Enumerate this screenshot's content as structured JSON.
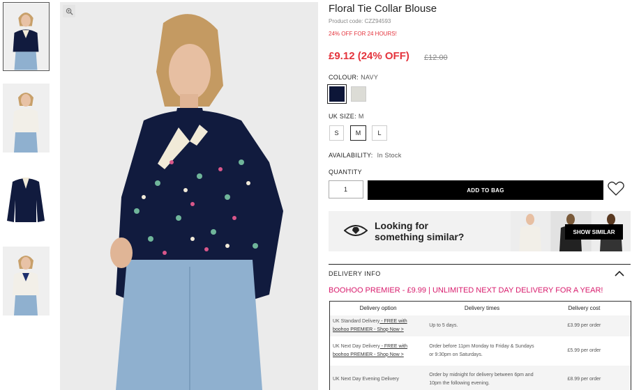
{
  "product": {
    "title": "Floral Tie Collar Blouse",
    "code": "Product code: CZZ94593",
    "promo": "24% OFF FOR 24 HOURS!",
    "price": "£9.12 (24% OFF)",
    "was_price": "£12.00"
  },
  "colour": {
    "label": "COLOUR:",
    "value": "NAVY",
    "swatches": [
      "#0d1638",
      "#dcdcd6"
    ]
  },
  "size": {
    "label": "UK SIZE:",
    "value": "M",
    "options": [
      "S",
      "M",
      "L"
    ]
  },
  "availability": {
    "label": "AVAILABILITY:",
    "value": "In Stock"
  },
  "quantity": {
    "label": "QUANTITY",
    "value": "1"
  },
  "add_to_bag": "ADD TO BAG",
  "similar": {
    "line1": "Looking for",
    "line2": "something similar?",
    "button": "SHOW SIMILAR"
  },
  "delivery": {
    "heading": "DELIVERY INFO",
    "premier": "BOOHOO PREMIER - £9.99 | UNLIMITED NEXT DAY DELIVERY FOR A YEAR!",
    "columns": [
      "Delivery option",
      "Delivery times",
      "Delivery cost"
    ],
    "rows": [
      {
        "option": "UK Standard Delivery",
        "link": " - FREE with boohoo PREMIER - Shop Now >",
        "time": "Up to 5 days.",
        "cost": "£3.99 per order"
      },
      {
        "option": "UK Next Day Delivery",
        "link": " - FREE with boohoo PREMIER - Shop Now >",
        "time": "Order before 11pm Monday to Friday & Sundays or 9:30pm on Saturdays.",
        "cost": "£5.99 per order"
      },
      {
        "option": "UK Next Day Evening Delivery",
        "link": "",
        "time": "Order by midnight for delivery between 6pm and 10pm the following evening.",
        "cost": "£8.99 per order"
      }
    ]
  },
  "colors": {
    "sale_red": "#e4333c",
    "premier_pink": "#d81b6c",
    "navy": "#0d1638"
  },
  "icons": [
    "zoom-icon",
    "heart-icon",
    "eye-icon",
    "chevron-up-icon"
  ]
}
